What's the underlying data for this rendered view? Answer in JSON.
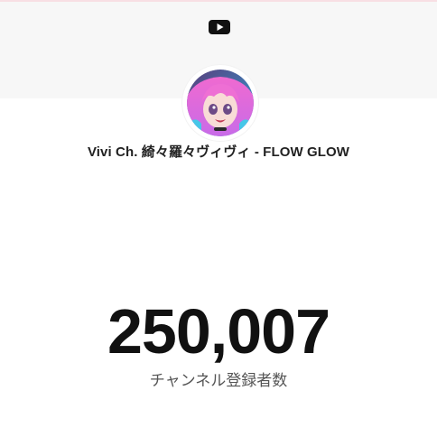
{
  "header": {
    "logo_icon": "youtube-icon",
    "banner_color": "#f7f7f7",
    "accent_color": "#f8dfe4"
  },
  "channel": {
    "name": "Vivi Ch. 綺々羅々ヴィヴィ - FLOW GLOW",
    "avatar_icon": "channel-avatar"
  },
  "stats": {
    "subscriber_count": "250,007",
    "subscriber_label": "チャンネル登録者数"
  }
}
